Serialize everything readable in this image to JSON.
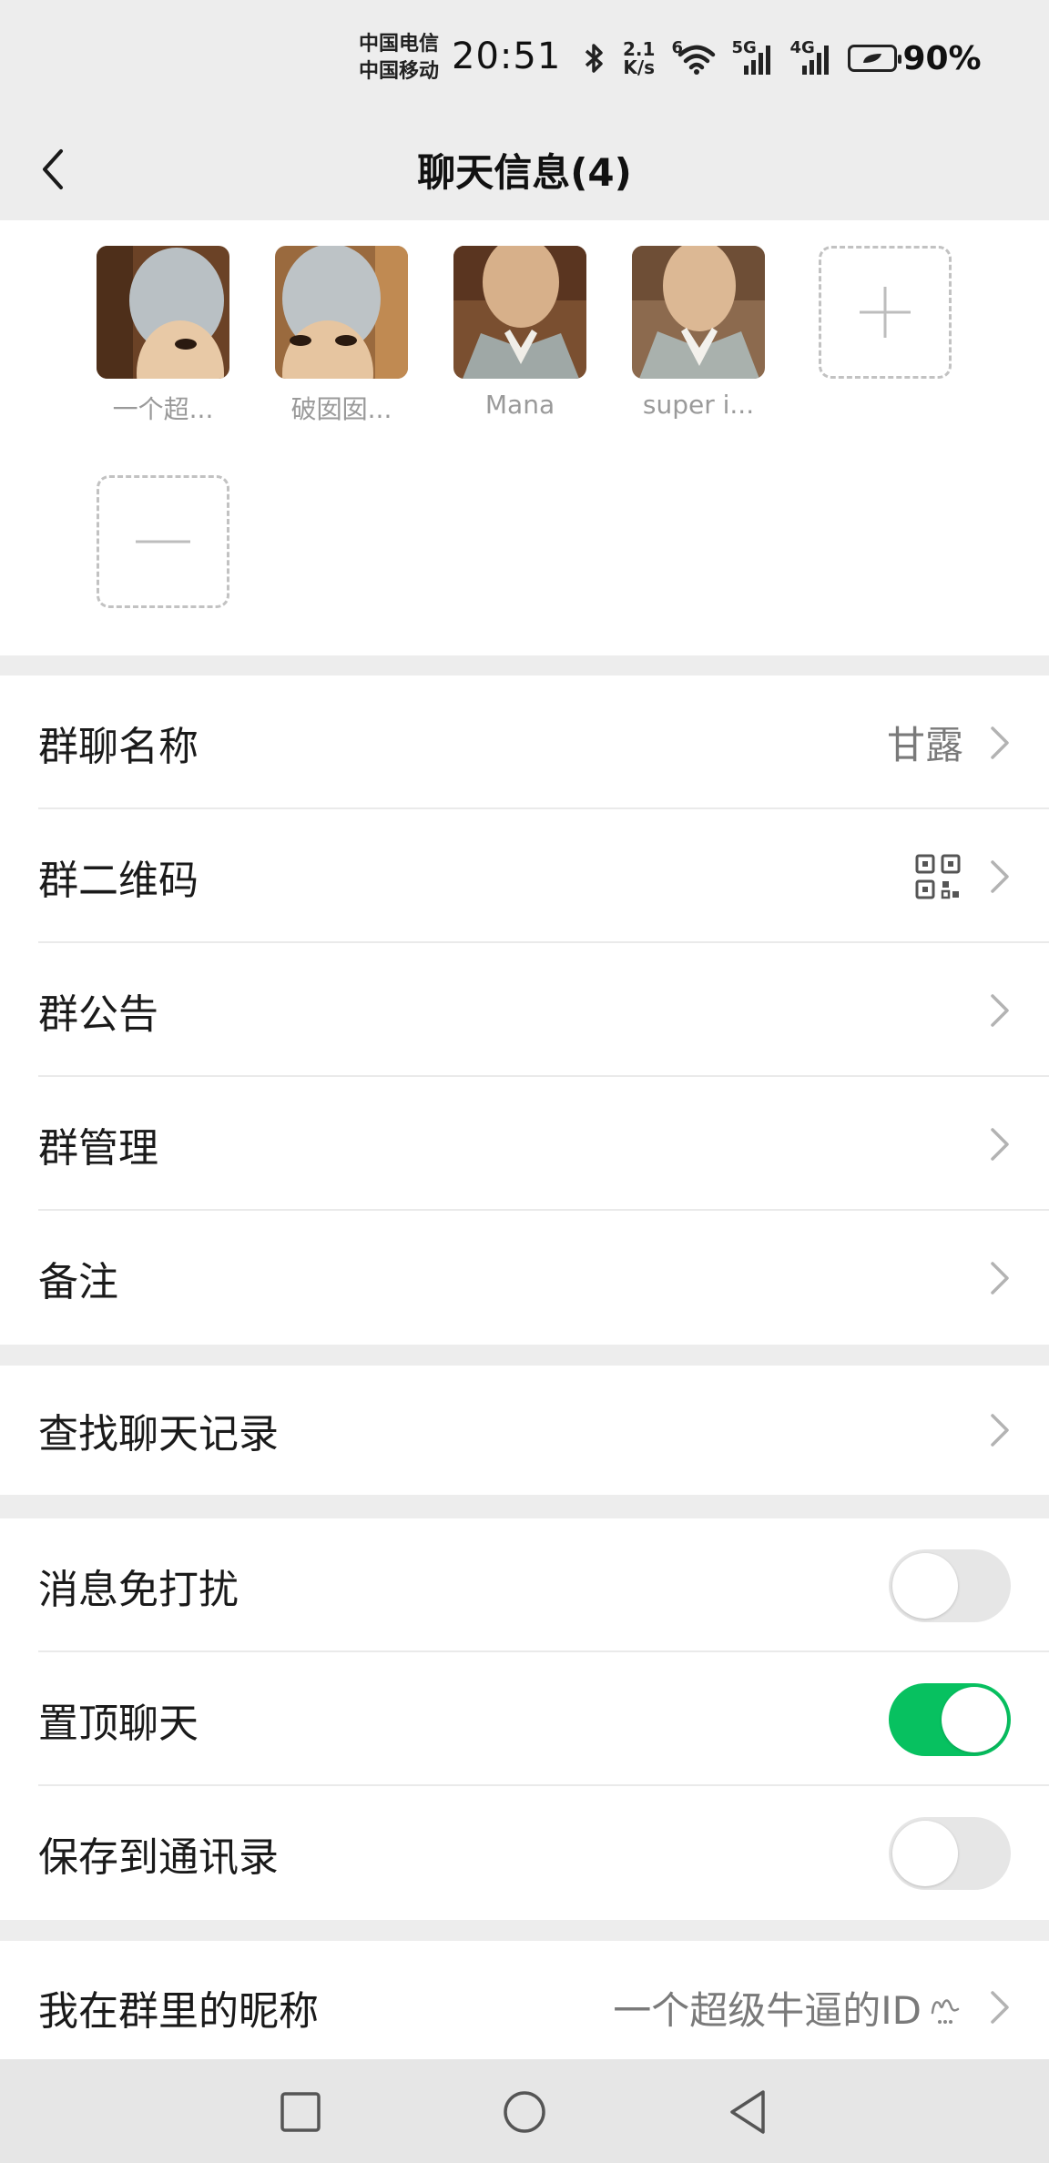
{
  "status_bar": {
    "carrier_1": "中国电信",
    "carrier_2": "中国移动",
    "time": "20:51",
    "net_speed_value": "2.1",
    "net_speed_unit": "K/s",
    "wifi_badge": "6",
    "signal_1_label": "5G",
    "signal_2_label": "4G",
    "battery": "90%"
  },
  "nav": {
    "title": "聊天信息(4)"
  },
  "members": [
    {
      "name": "一个超..."
    },
    {
      "name": "破囡囡..."
    },
    {
      "name": "Mana"
    },
    {
      "name": "super i..."
    }
  ],
  "group_info": {
    "name_label": "群聊名称",
    "name_value": "甘露",
    "qr_label": "群二维码",
    "notice_label": "群公告",
    "manage_label": "群管理",
    "remark_label": "备注"
  },
  "search": {
    "label": "查找聊天记录"
  },
  "settings": {
    "mute_label": "消息免打扰",
    "mute_on": false,
    "pin_label": "置顶聊天",
    "pin_on": true,
    "save_label": "保存到通讯录",
    "save_on": false
  },
  "nickname": {
    "label": "我在群里的昵称",
    "value": "一个超级牛逼的ID"
  },
  "colors": {
    "accent": "#07c160",
    "background": "#ededed",
    "card": "#ffffff"
  }
}
